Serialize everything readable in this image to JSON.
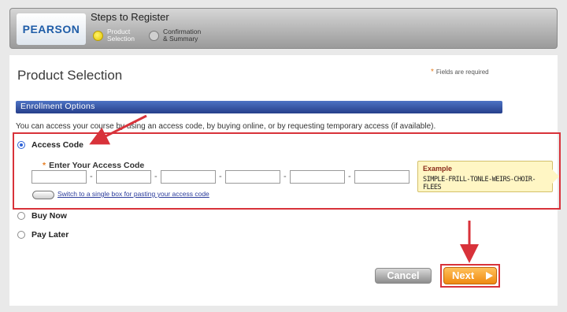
{
  "header": {
    "logo": "PEARSON",
    "steps_title": "Steps to Register",
    "steps": [
      {
        "line1": "Product",
        "line2": "Selection"
      },
      {
        "line1": "Confirmation",
        "line2": "& Summary"
      }
    ]
  },
  "page": {
    "title": "Product Selection",
    "required_note": "Fields are required",
    "required_star": "*",
    "section_title": "Enrollment Options",
    "intro": "You can access your course by using an access code, by buying online, or by requesting temporary access (if available)."
  },
  "options": {
    "access_code": "Access Code",
    "buy_now": "Buy Now",
    "pay_later": "Pay Later"
  },
  "access_code": {
    "label": "Enter Your Access Code",
    "star": "*",
    "dash": "-",
    "switch_link": "Switch to a single box for pasting your access code",
    "example_title": "Example",
    "example_code": "SIMPLE-FRILL-TONLE-WEIRS-CHOIR-FLEES"
  },
  "buttons": {
    "cancel": "Cancel",
    "next": "Next"
  },
  "colors": {
    "accent": "#ef8a10",
    "section_bar": "#2d4a9c",
    "highlight": "#d8323a"
  }
}
